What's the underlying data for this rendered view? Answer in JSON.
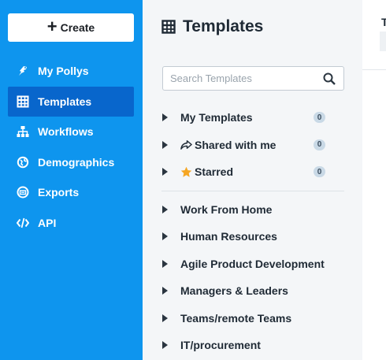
{
  "sidebar": {
    "create_label": "Create",
    "items": [
      {
        "label": "My Pollys",
        "icon": "polly-icon"
      },
      {
        "label": "Templates",
        "icon": "templates-icon",
        "active": true
      },
      {
        "label": "Workflows",
        "icon": "workflows-icon"
      },
      {
        "label": "Demographics",
        "icon": "demographics-icon"
      },
      {
        "label": "Exports",
        "icon": "exports-icon"
      },
      {
        "label": "API",
        "icon": "code-icon"
      }
    ]
  },
  "panel": {
    "title": "Templates",
    "search_placeholder": "Search Templates",
    "personal": [
      {
        "label": "My Templates",
        "count": "0"
      },
      {
        "label": "Shared with me",
        "count": "0",
        "icon": "share-icon"
      },
      {
        "label": "Starred",
        "count": "0",
        "icon": "star-icon"
      }
    ],
    "categories": [
      "Work From Home",
      "Human Resources",
      "Agile Product Development",
      "Managers & Leaders",
      "Teams/remote Teams",
      "IT/procurement"
    ]
  },
  "right": {
    "title_fragment": "T"
  },
  "colors": {
    "sidebar_bg": "#0e95ee",
    "sidebar_active": "#0866cc",
    "panel_bg": "#f4f6f8",
    "star": "#f5a623"
  }
}
